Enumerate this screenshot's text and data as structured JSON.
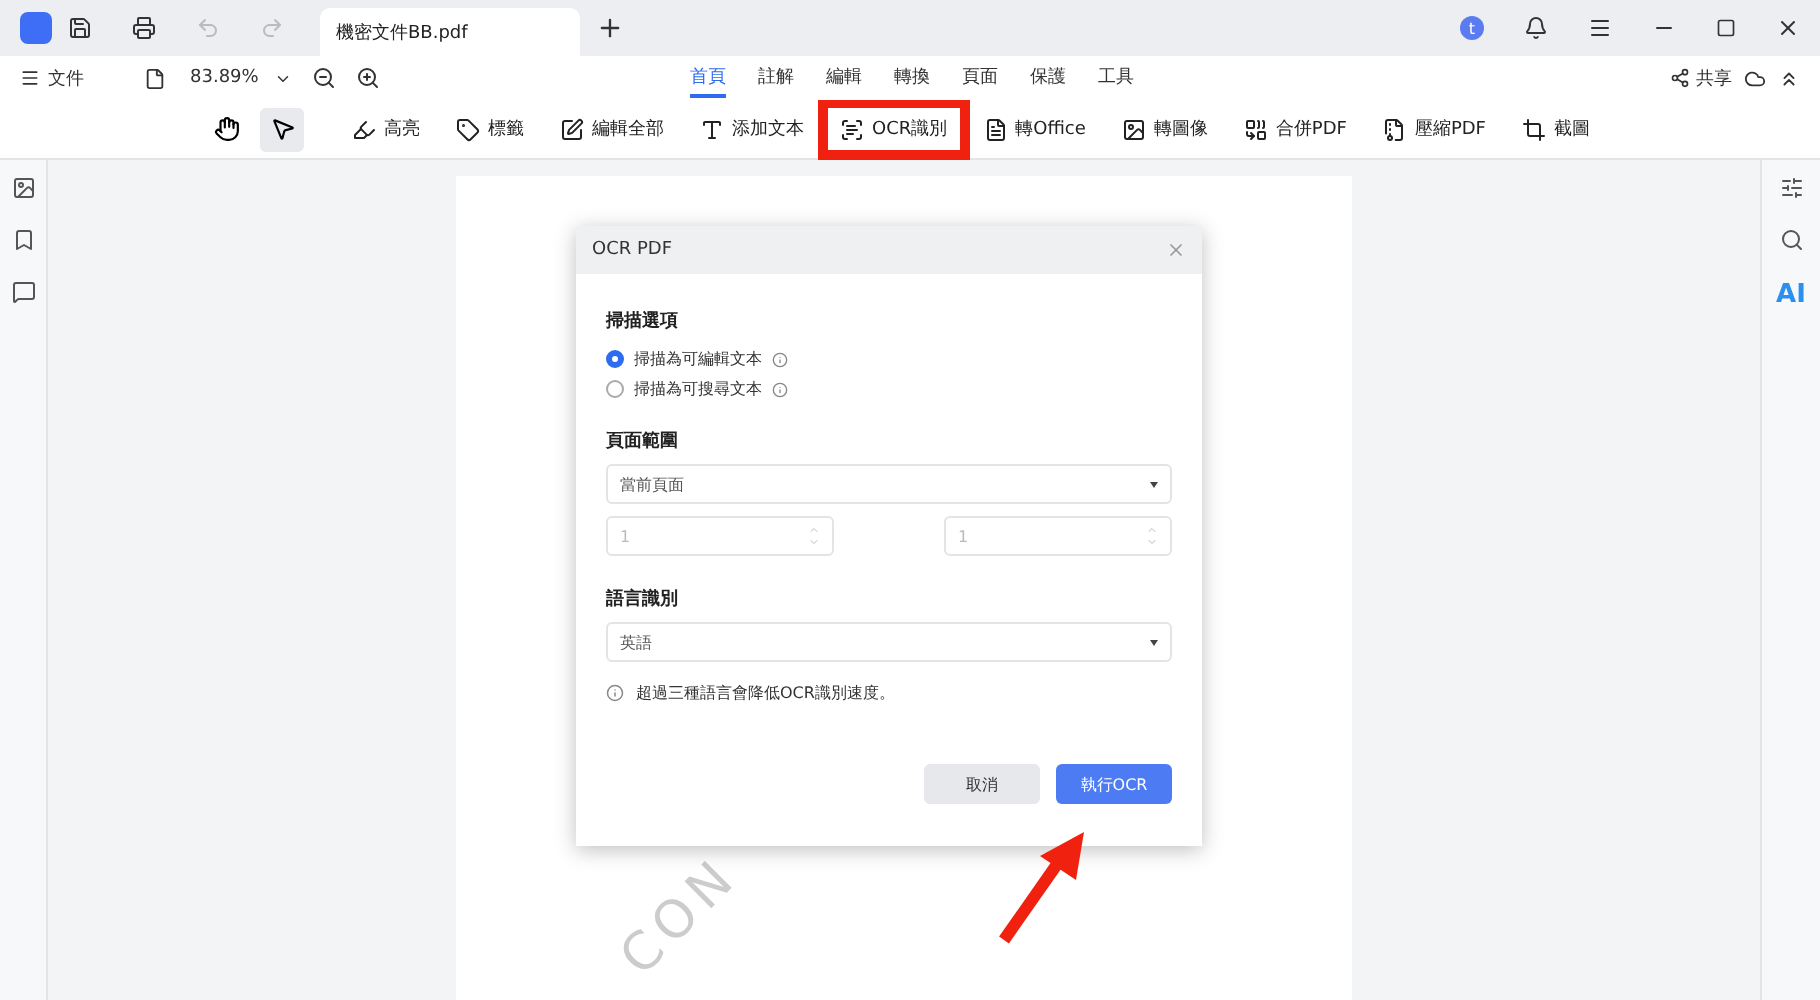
{
  "titlebar": {
    "tab_title": "機密文件BB.pdf",
    "avatar": "t"
  },
  "menubar": {
    "file_menu": "文件",
    "zoom": "83.89%",
    "tabs": [
      {
        "label": "首頁",
        "selected": true
      },
      {
        "label": "註解",
        "selected": false
      },
      {
        "label": "編輯",
        "selected": false
      },
      {
        "label": "轉換",
        "selected": false
      },
      {
        "label": "頁面",
        "selected": false
      },
      {
        "label": "保護",
        "selected": false
      },
      {
        "label": "工具",
        "selected": false
      }
    ],
    "share": "共享"
  },
  "toolbar": {
    "tools": [
      {
        "kind": "hand",
        "selected": false
      },
      {
        "kind": "cursor",
        "selected": true
      }
    ],
    "buttons": [
      {
        "kind": "highlight",
        "label": "高亮",
        "highlighted": false
      },
      {
        "kind": "tag",
        "label": "標籤",
        "highlighted": false
      },
      {
        "kind": "edit",
        "label": "編輯全部",
        "highlighted": false
      },
      {
        "kind": "text",
        "label": "添加文本",
        "highlighted": false
      },
      {
        "kind": "ocr",
        "label": "OCR識別",
        "highlighted": true
      },
      {
        "kind": "office",
        "label": "轉Office",
        "highlighted": false
      },
      {
        "kind": "image",
        "label": "轉圖像",
        "highlighted": false
      },
      {
        "kind": "merge",
        "label": "合併PDF",
        "highlighted": false
      },
      {
        "kind": "compress",
        "label": "壓縮PDF",
        "highlighted": false
      },
      {
        "kind": "screenshot",
        "label": "截圖",
        "highlighted": false
      }
    ]
  },
  "document": {
    "watermark": "CON"
  },
  "rightbar": {
    "ai_label": "AI"
  },
  "dialog": {
    "title": "OCR PDF",
    "scan_heading": "掃描選項",
    "scan_options": [
      {
        "label": "掃描為可編輯文本",
        "selected": true
      },
      {
        "label": "掃描為可搜尋文本",
        "selected": false
      }
    ],
    "range_heading": "頁面範圍",
    "range_select": "當前頁面",
    "range_from": "1",
    "range_to": "1",
    "lang_heading": "語言識別",
    "lang_select": "英語",
    "note": "超過三種語言會降低OCR識別速度。",
    "cancel": "取消",
    "run": "執行OCR"
  }
}
